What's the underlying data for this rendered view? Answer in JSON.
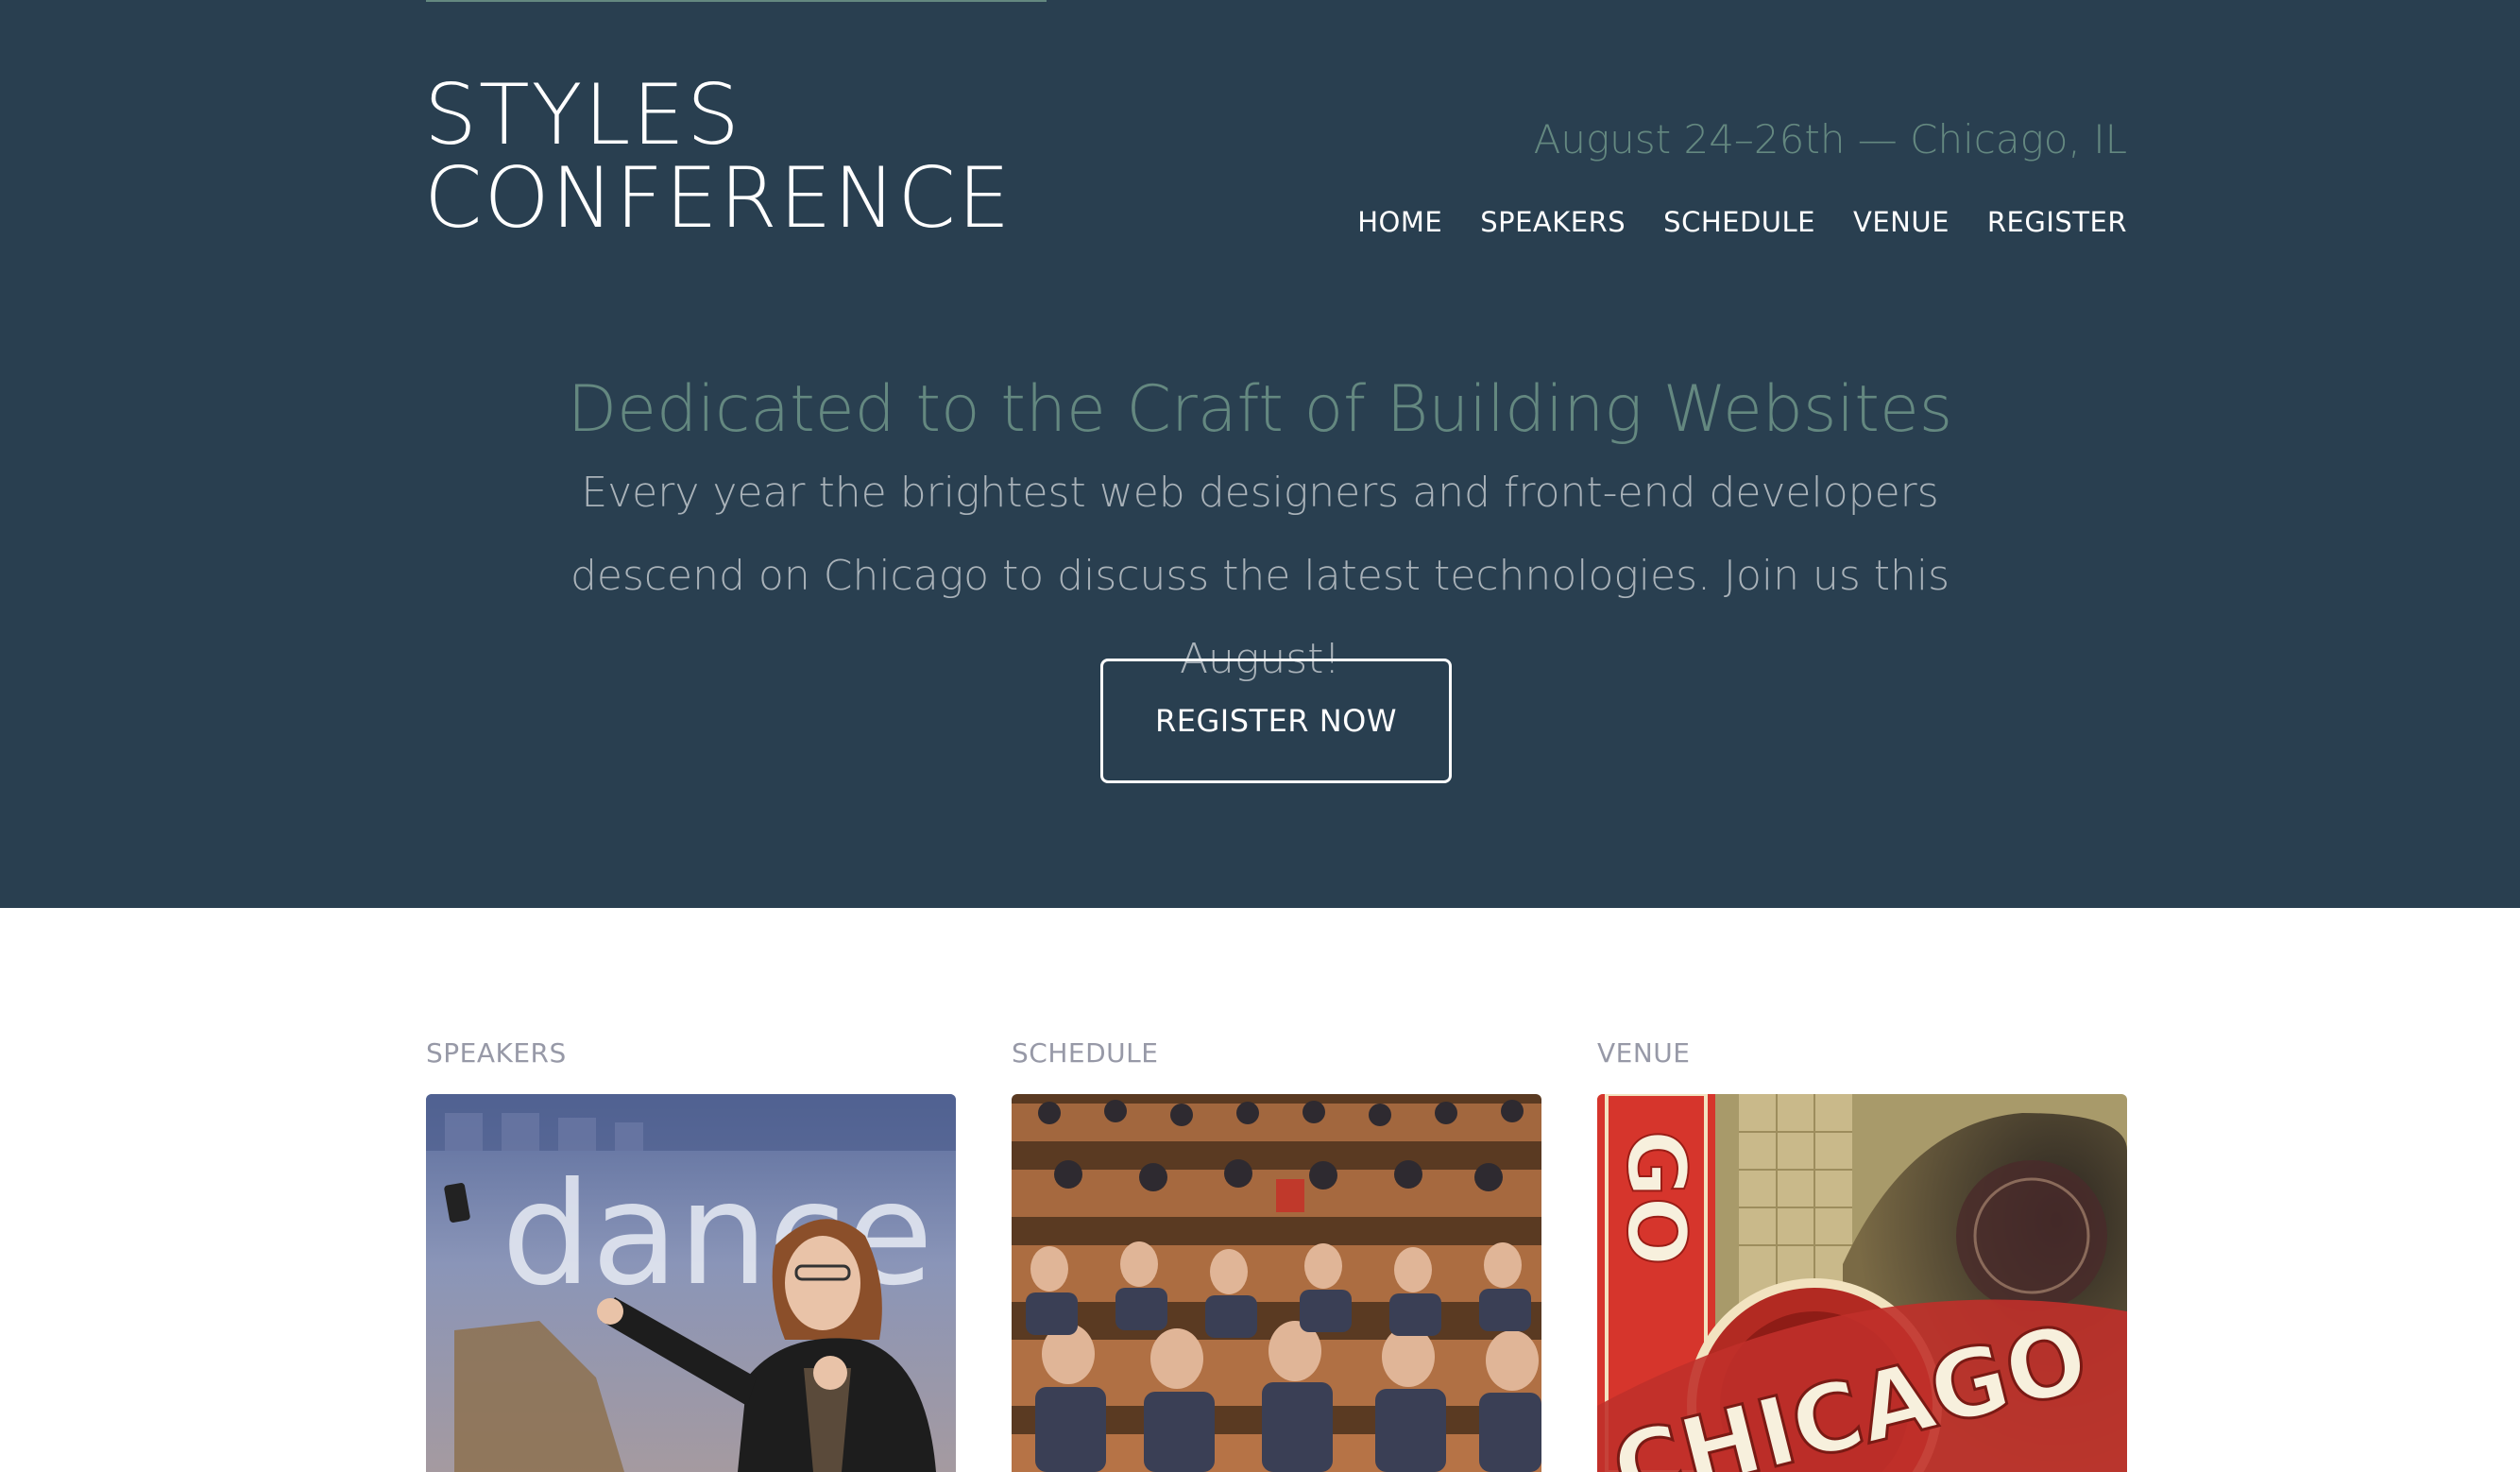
{
  "header": {
    "logo_line1": "STYLES",
    "logo_line2": "CONFERENCE",
    "dates": "August 24–26th — Chicago, IL",
    "nav": [
      {
        "label": "HOME"
      },
      {
        "label": "SPEAKERS"
      },
      {
        "label": "SCHEDULE"
      },
      {
        "label": "VENUE"
      },
      {
        "label": "REGISTER"
      }
    ]
  },
  "hero": {
    "headline": "Dedicated to the Craft of Building Websites",
    "lead": "Every year the brightest web designers and front-end developers descend on Chicago to discuss the latest technologies. Join us this August!",
    "cta_label": "REGISTER NOW"
  },
  "teasers": [
    {
      "title": "SPEAKERS",
      "image": "speaker-photo"
    },
    {
      "title": "SCHEDULE",
      "image": "audience-photo"
    },
    {
      "title": "VENUE",
      "image": "chicago-theatre-sign-photo"
    }
  ],
  "colors": {
    "hero_bg": "#293f50",
    "accent": "#648880",
    "lead_text": "#a9b2b9",
    "teaser_title": "#9799a7"
  },
  "photo_text": {
    "speaker_slide": "dance",
    "venue_sign_horizontal": "CHICAGO",
    "venue_sign_vertical": "GO"
  }
}
